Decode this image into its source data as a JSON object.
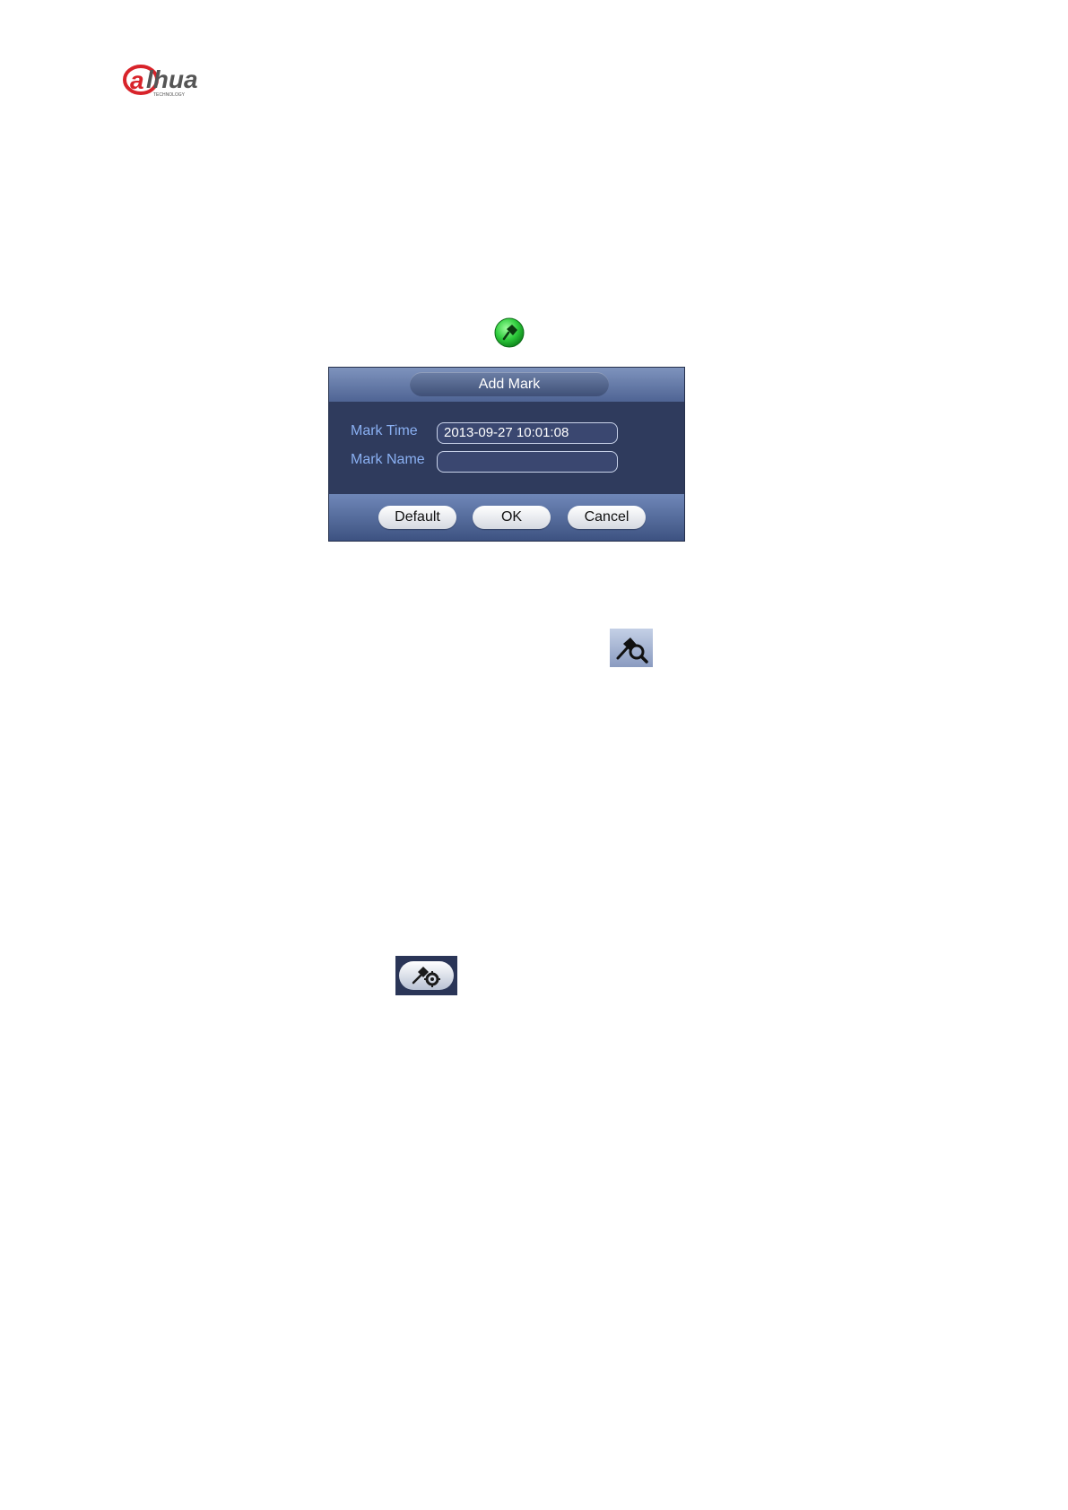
{
  "logo": {
    "text": "alhua",
    "subtext": "TECHNOLOGY",
    "color": "#d8232a"
  },
  "icons": {
    "add_mark": "green-pin-icon",
    "mark_search": "pin-search-icon",
    "mark_manage": "pin-gear-icon"
  },
  "dialog": {
    "title": "Add Mark",
    "fields": [
      {
        "label": "Mark Time",
        "value": "2013-09-27 10:01:08"
      },
      {
        "label": "Mark Name",
        "value": ""
      }
    ],
    "buttons": {
      "default": "Default",
      "ok": "OK",
      "cancel": "Cancel"
    },
    "colors": {
      "body": "#2f3b5d",
      "label": "#8ab0f2",
      "titlebar": "#6f87b8"
    }
  }
}
